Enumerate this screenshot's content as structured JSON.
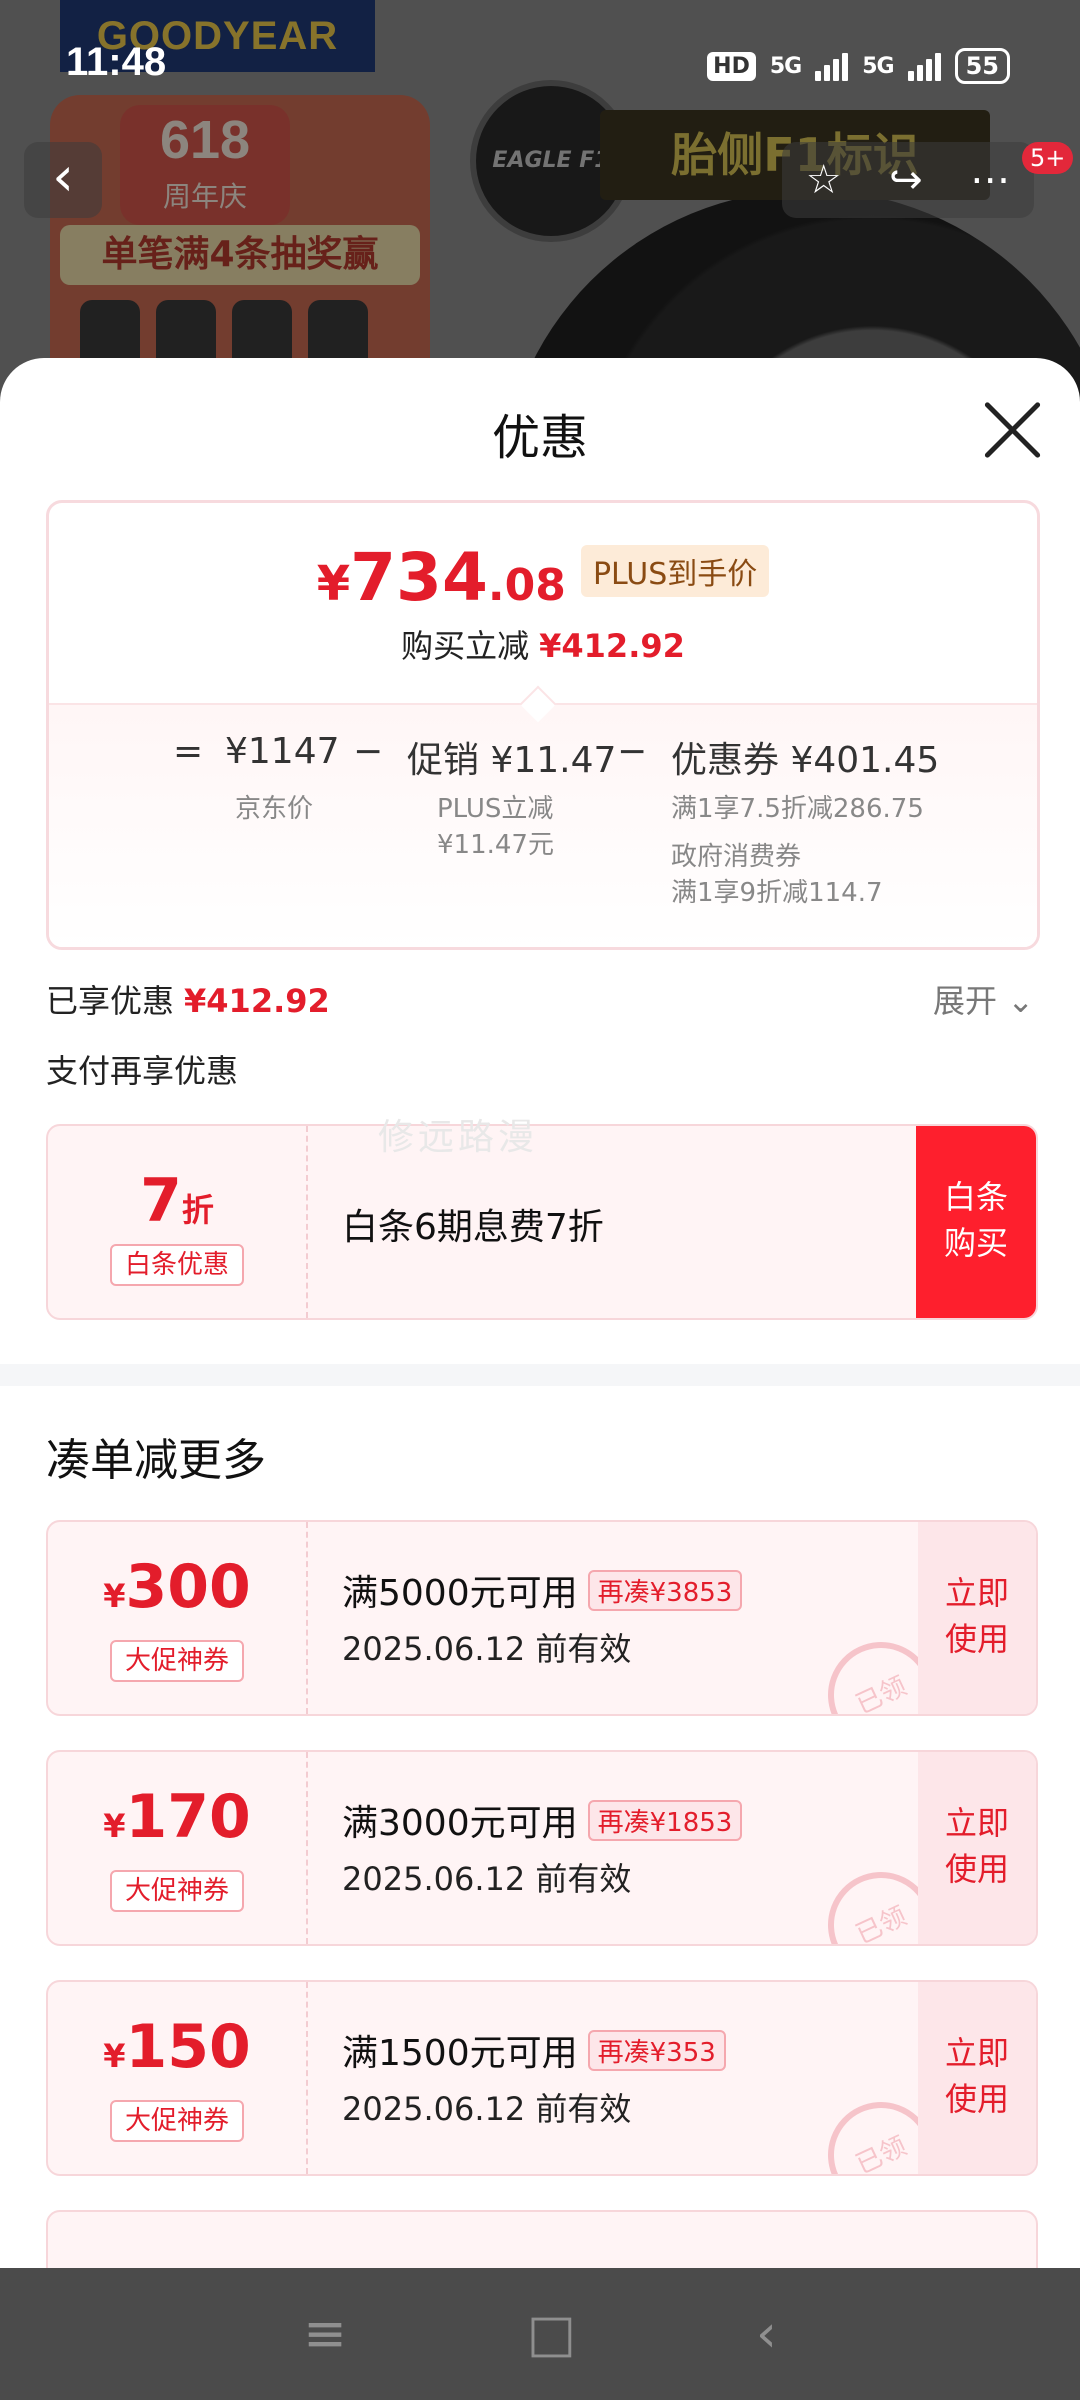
{
  "status": {
    "time": "11:48",
    "hd": "HD",
    "net1": "5G",
    "net2": "5G",
    "battery": "55"
  },
  "background": {
    "brand": "GOODYEAR",
    "promo_badge_number": "618",
    "promo_badge_text": "周年庆",
    "promo_lottery": "单笔满4条抽奖赢",
    "tire_model": "EAGLE F1",
    "sidewall_text": "胎侧F1标识",
    "message_badge": "5+"
  },
  "sheet": {
    "title": "优惠",
    "price": {
      "yen": "¥",
      "integer": "734",
      "decimal": ".08",
      "plus_label": "PLUS到手价",
      "instant_cut_label": "购买立减",
      "instant_cut_value": "¥412.92"
    },
    "breakdown": {
      "eq": "=",
      "jd_price": "¥1147",
      "jd_price_label": "京东价",
      "minus1": "−",
      "promo": "促销 ¥11.47",
      "promo_label_1": "PLUS立减",
      "promo_label_2": "¥11.47元",
      "minus2": "−",
      "coupon": "优惠券 ¥401.45",
      "coupon_label_1": "满1享7.5折减286.75",
      "coupon_label_2": "政府消费券",
      "coupon_label_3": "满1享9折减114.7"
    },
    "enjoyed_label": "已享优惠",
    "enjoyed_value": "¥412.92",
    "expand_label": "展开",
    "pay_more_label": "支付再享优惠",
    "baitiao": {
      "amount": "7",
      "unit": "折",
      "tag": "白条优惠",
      "desc": "白条6期息费7折",
      "button_line1": "白条",
      "button_line2": "购买"
    },
    "watermark": "修远路漫",
    "section_title": "凑单减更多",
    "coupons": [
      {
        "yen": "¥",
        "amount": "300",
        "tag": "大促神券",
        "title": "满5000元可用",
        "extra": "再凑¥3853",
        "date": "2025.06.12 前有效",
        "btn1": "立即",
        "btn2": "使用",
        "stamp": "已领"
      },
      {
        "yen": "¥",
        "amount": "170",
        "tag": "大促神券",
        "title": "满3000元可用",
        "extra": "再凑¥1853",
        "date": "2025.06.12 前有效",
        "btn1": "立即",
        "btn2": "使用",
        "stamp": "已领"
      },
      {
        "yen": "¥",
        "amount": "150",
        "tag": "大促神券",
        "title": "满1500元可用",
        "extra": "再凑¥353",
        "date": "2025.06.12 前有效",
        "btn1": "立即",
        "btn2": "使用",
        "stamp": "已领"
      }
    ]
  },
  "nav": {
    "menu_icon": "menu-icon",
    "home_icon": "home-icon",
    "back_icon": "back-icon"
  }
}
